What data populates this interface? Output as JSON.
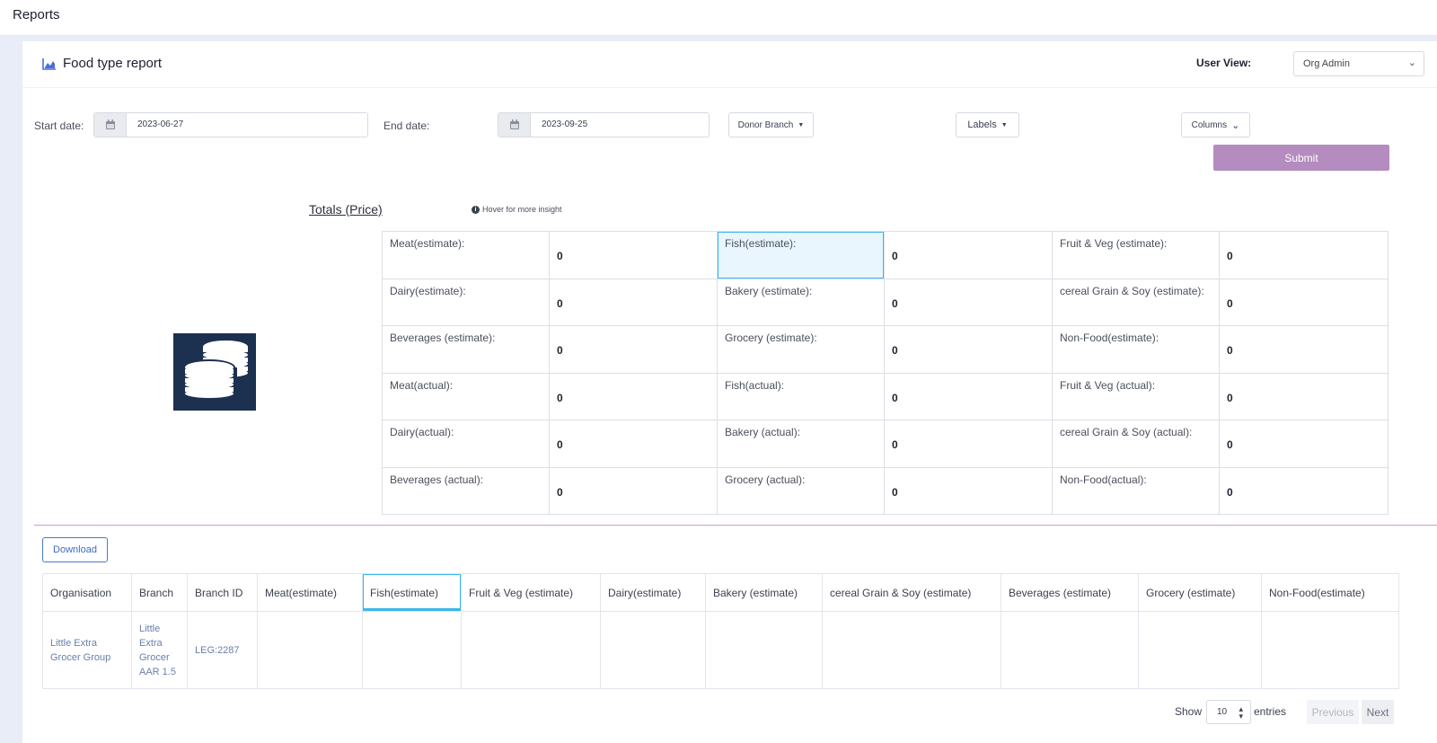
{
  "topbar": {
    "title": "Reports"
  },
  "report": {
    "title": "Food type report",
    "icon": "area-chart-icon",
    "user_view_label": "User View:",
    "user_view_value": "Org Admin"
  },
  "filters": {
    "start_label": "Start date:",
    "start_value": "2023-06-27",
    "end_label": "End date:",
    "end_value": "2023-09-25",
    "donor_branch": "Donor Branch",
    "labels": "Labels",
    "columns": "Columns",
    "submit": "Submit"
  },
  "totals": {
    "title": "Totals (Price)",
    "hover_note": "Hover for more insight",
    "cells": [
      [
        "Meat(estimate):",
        "0",
        "Fish(estimate):",
        "0",
        "Fruit & Veg (estimate):",
        "0"
      ],
      [
        "Dairy(estimate):",
        "0",
        "Bakery (estimate):",
        "0",
        "cereal Grain & Soy (estimate):",
        "0"
      ],
      [
        "Beverages (estimate):",
        "0",
        "Grocery (estimate):",
        "0",
        "Non-Food(estimate):",
        "0"
      ],
      [
        "Meat(actual):",
        "0",
        "Fish(actual):",
        "0",
        "Fruit & Veg (actual):",
        "0"
      ],
      [
        "Dairy(actual):",
        "0",
        "Bakery (actual):",
        "0",
        "cereal Grain & Soy (actual):",
        "0"
      ],
      [
        "Beverages (actual):",
        "0",
        "Grocery (actual):",
        "0",
        "Non-Food(actual):",
        "0"
      ]
    ]
  },
  "table": {
    "download": "Download",
    "headers": [
      "Organisation",
      "Branch",
      "Branch ID",
      "Meat(estimate)",
      "Fish(estimate)",
      "Fruit & Veg (estimate)",
      "Dairy(estimate)",
      "Bakery (estimate)",
      "cereal Grain & Soy (estimate)",
      "Beverages (estimate)",
      "Grocery (estimate)",
      "Non-Food(estimate)"
    ],
    "row": {
      "organisation": "Little Extra Grocer Group",
      "branch": "Little Extra Grocer AAR 1.5",
      "branch_id": "LEG:2287"
    }
  },
  "pager": {
    "show": "Show",
    "page_size": "10",
    "entries": "entries",
    "previous": "Previous",
    "next": "Next"
  }
}
